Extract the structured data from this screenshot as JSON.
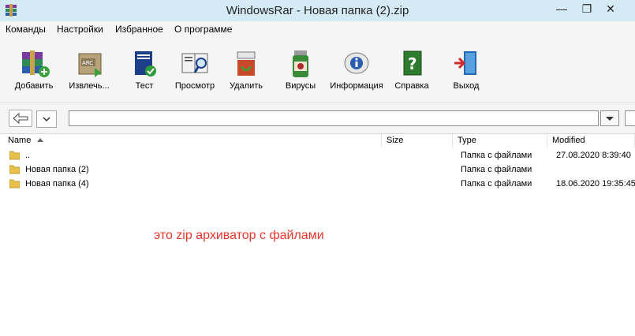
{
  "window": {
    "title": "WindowsRar - Новая папка (2).zip",
    "buttons": [
      "—",
      "❐",
      "✕"
    ]
  },
  "menu": [
    "Команды",
    "Настройки",
    "Избранное",
    "О программе"
  ],
  "toolbar": [
    {
      "label": "Добавить",
      "icon": "add-archive-icon"
    },
    {
      "label": "Извлечь...",
      "icon": "extract-icon"
    },
    {
      "label": "Тест",
      "icon": "test-icon"
    },
    {
      "label": "Просмотр",
      "icon": "view-icon"
    },
    {
      "label": "Удалить",
      "icon": "delete-icon"
    },
    {
      "label": "Вирусы",
      "icon": "virus-scan-icon"
    },
    {
      "label": "Информация",
      "icon": "info-icon"
    },
    {
      "label": "Справка",
      "icon": "help-icon"
    },
    {
      "label": "Выход",
      "icon": "exit-icon"
    }
  ],
  "address": {
    "value": ""
  },
  "columns": {
    "name": "Name",
    "size": "Size",
    "type": "Type",
    "modified": "Modified"
  },
  "files": [
    {
      "name": "..",
      "size": "",
      "type": "Папка с файлами",
      "modified": "27.08.2020 8:39:40"
    },
    {
      "name": "Новая папка (2)",
      "size": "",
      "type": "Папка с файлами",
      "modified": ""
    },
    {
      "name": "Новая папка (4)",
      "size": "",
      "type": "Папка с файлами",
      "modified": "18.06.2020 19:35:45"
    }
  ],
  "annotation": "это zip архиватор с файлами"
}
